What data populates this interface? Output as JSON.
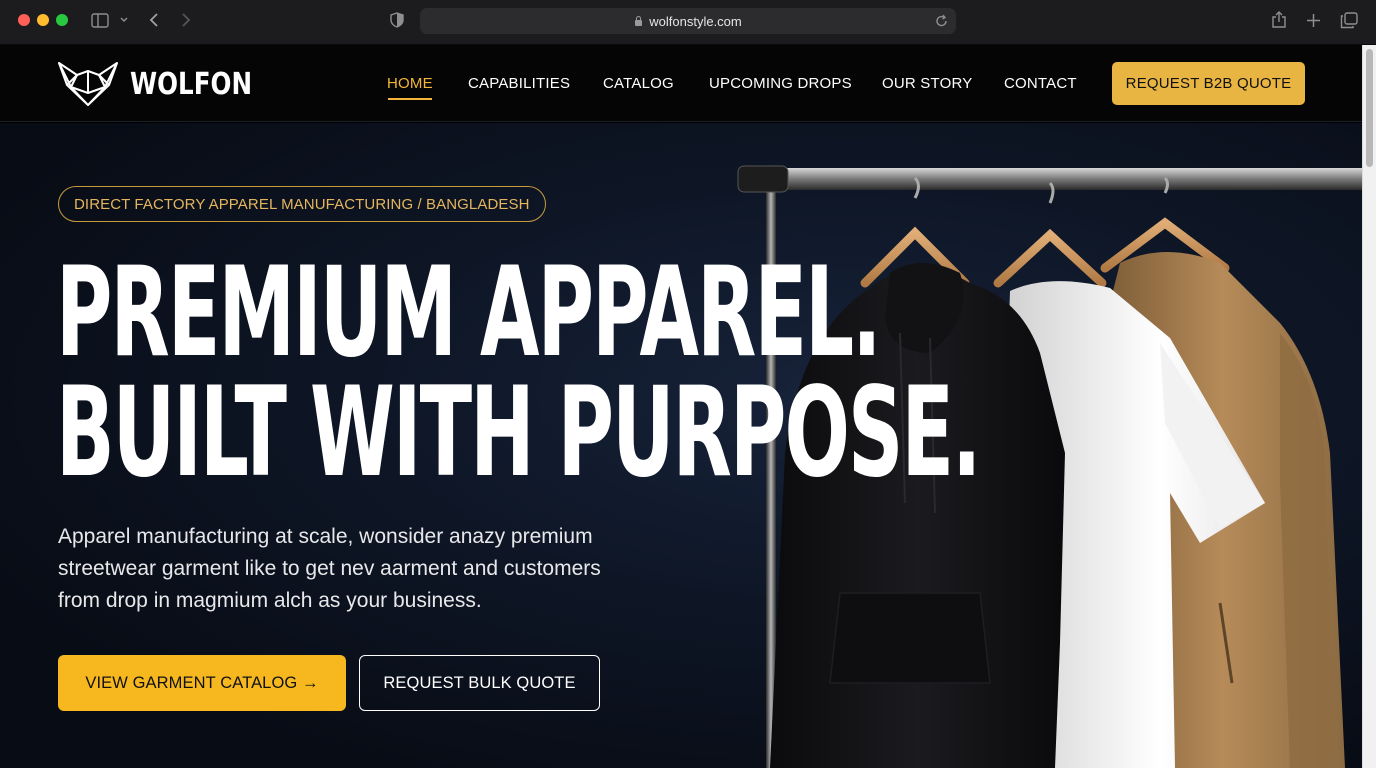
{
  "browser": {
    "url": "wolfonstyle.com"
  },
  "header": {
    "brand": "WOLFON",
    "nav": [
      {
        "label": "HOME",
        "active": true
      },
      {
        "label": "CAPABILITIES",
        "active": false
      },
      {
        "label": "CATALOG",
        "active": false
      },
      {
        "label": "UPCOMING DROPS",
        "active": false
      },
      {
        "label": "OUR STORY",
        "active": false
      },
      {
        "label": "CONTACT",
        "active": false
      }
    ],
    "cta_label": "REQUEST B2B QUOTE"
  },
  "hero": {
    "badge": "DIRECT FACTORY APPAREL MANUFACTURING / BANGLADESH",
    "headline_line1": "PREMIUM APPAREL.",
    "headline_line2": "BUILT WITH PURPOSE.",
    "subcopy": "Apparel manufacturing at scale, wonsider anazy premium streetwear garment like to get nev aarment and customers from drop in magmium alch as your business.",
    "primary_button": "VIEW GARMENT CATALOG →",
    "secondary_button": "REQUEST BULK QUOTE"
  },
  "colors": {
    "accent": "#f3b63a",
    "primary_button_bg": "#f6b81e",
    "hero_bg": "#0e1626"
  },
  "icons": {
    "sidebar": "sidebar-icon",
    "back": "chevron-left-icon",
    "forward": "chevron-right-icon",
    "shield": "shield-icon",
    "reload": "reload-icon",
    "share": "share-icon",
    "new_tab": "plus-icon",
    "tabs": "tabs-overview-icon",
    "logo": "wolf-logo-icon"
  }
}
